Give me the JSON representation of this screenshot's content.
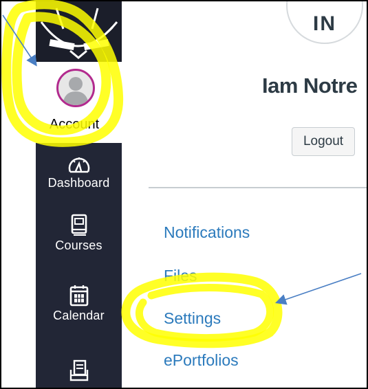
{
  "nav": {
    "account_label": "Account",
    "items": [
      {
        "label": "Dashboard",
        "icon": "dashboard-icon"
      },
      {
        "label": "Courses",
        "icon": "courses-icon"
      },
      {
        "label": "Calendar",
        "icon": "calendar-icon"
      },
      {
        "label": "",
        "icon": "inbox-icon"
      }
    ]
  },
  "profile": {
    "initials": "IN",
    "name": "Iam Notre",
    "logout_label": "Logout"
  },
  "links": [
    "Notifications",
    "Files",
    "Settings",
    "ePortfolios"
  ],
  "colors": {
    "nav_bg": "#222636",
    "link": "#2b7abc",
    "avatar_ring": "#b22a8e",
    "highlight": "#ffff00",
    "arrow": "#4a7fc4"
  }
}
